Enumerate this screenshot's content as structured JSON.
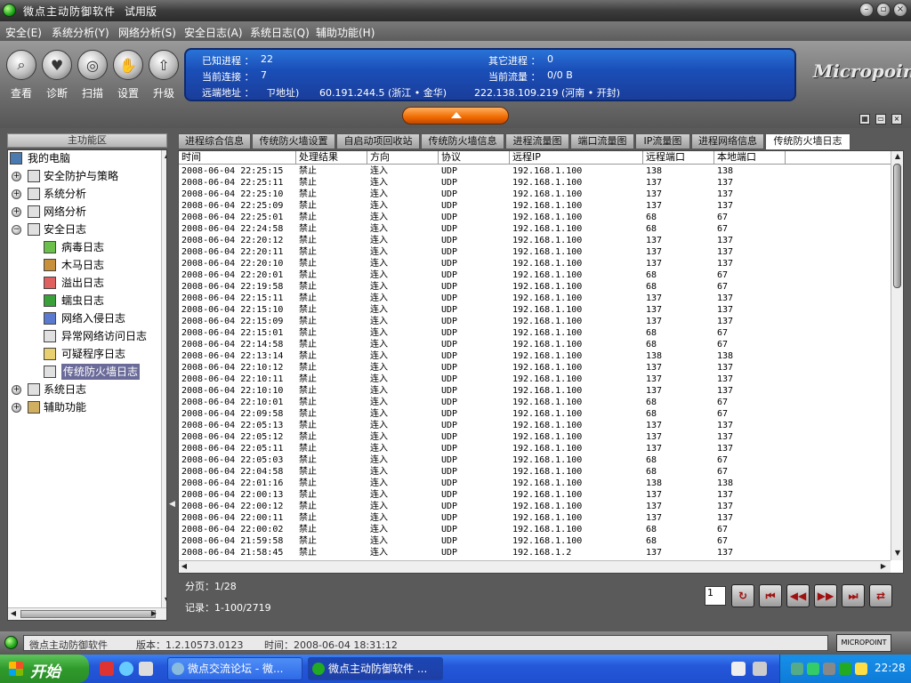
{
  "window": {
    "title": "微点主动防御软件",
    "edition": "试用版"
  },
  "menu": [
    "安全(E)",
    "系统分析(Y)",
    "网络分析(S)",
    "安全日志(A)",
    "系统日志(Q)",
    "辅助功能(H)"
  ],
  "toolbar": [
    "查看",
    "诊断",
    "扫描",
    "设置",
    "升级"
  ],
  "info": {
    "known_proc_label": "已知进程 ：",
    "known_proc": "22",
    "other_proc_label": "其它进程 ：",
    "other_proc": "0",
    "conn_label": "当前连接 ：",
    "conn": "7",
    "traffic_label": "当前流量 ：",
    "traffic": "0/0 B",
    "remote_label": "远端地址 ：",
    "remote_note": "ㄗ地址)",
    "remote_1": "60.191.244.5 (浙江 • 金华)",
    "remote_2": "222.138.109.219 (河南 • 开封)"
  },
  "logo": "Micropoint",
  "tree": {
    "header": "主功能区",
    "root": "我的电脑",
    "items": [
      "安全防护与策略",
      "系统分析",
      "网络分析",
      "安全日志",
      "病毒日志",
      "木马日志",
      "溢出日志",
      "蠕虫日志",
      "网络入侵日志",
      "异常网络访问日志",
      "可疑程序日志",
      "传统防火墙日志",
      "系统日志",
      "辅助功能"
    ]
  },
  "tabs": [
    "进程综合信息",
    "传统防火墙设置",
    "自启动项回收站",
    "传统防火墙信息",
    "进程流量图",
    "端口流量图",
    "IP流量图",
    "进程网络信息",
    "传统防火墙日志"
  ],
  "table": {
    "columns": [
      "时间",
      "处理结果",
      "方向",
      "协议",
      "远程IP",
      "远程端口",
      "本地端口"
    ],
    "rows": [
      [
        "2008-06-04 22:25:15",
        "禁止",
        "连入",
        "UDP",
        "192.168.1.100",
        "138",
        "138"
      ],
      [
        "2008-06-04 22:25:11",
        "禁止",
        "连入",
        "UDP",
        "192.168.1.100",
        "137",
        "137"
      ],
      [
        "2008-06-04 22:25:10",
        "禁止",
        "连入",
        "UDP",
        "192.168.1.100",
        "137",
        "137"
      ],
      [
        "2008-06-04 22:25:09",
        "禁止",
        "连入",
        "UDP",
        "192.168.1.100",
        "137",
        "137"
      ],
      [
        "2008-06-04 22:25:01",
        "禁止",
        "连入",
        "UDP",
        "192.168.1.100",
        "68",
        "67"
      ],
      [
        "2008-06-04 22:24:58",
        "禁止",
        "连入",
        "UDP",
        "192.168.1.100",
        "68",
        "67"
      ],
      [
        "2008-06-04 22:20:12",
        "禁止",
        "连入",
        "UDP",
        "192.168.1.100",
        "137",
        "137"
      ],
      [
        "2008-06-04 22:20:11",
        "禁止",
        "连入",
        "UDP",
        "192.168.1.100",
        "137",
        "137"
      ],
      [
        "2008-06-04 22:20:10",
        "禁止",
        "连入",
        "UDP",
        "192.168.1.100",
        "137",
        "137"
      ],
      [
        "2008-06-04 22:20:01",
        "禁止",
        "连入",
        "UDP",
        "192.168.1.100",
        "68",
        "67"
      ],
      [
        "2008-06-04 22:19:58",
        "禁止",
        "连入",
        "UDP",
        "192.168.1.100",
        "68",
        "67"
      ],
      [
        "2008-06-04 22:15:11",
        "禁止",
        "连入",
        "UDP",
        "192.168.1.100",
        "137",
        "137"
      ],
      [
        "2008-06-04 22:15:10",
        "禁止",
        "连入",
        "UDP",
        "192.168.1.100",
        "137",
        "137"
      ],
      [
        "2008-06-04 22:15:09",
        "禁止",
        "连入",
        "UDP",
        "192.168.1.100",
        "137",
        "137"
      ],
      [
        "2008-06-04 22:15:01",
        "禁止",
        "连入",
        "UDP",
        "192.168.1.100",
        "68",
        "67"
      ],
      [
        "2008-06-04 22:14:58",
        "禁止",
        "连入",
        "UDP",
        "192.168.1.100",
        "68",
        "67"
      ],
      [
        "2008-06-04 22:13:14",
        "禁止",
        "连入",
        "UDP",
        "192.168.1.100",
        "138",
        "138"
      ],
      [
        "2008-06-04 22:10:12",
        "禁止",
        "连入",
        "UDP",
        "192.168.1.100",
        "137",
        "137"
      ],
      [
        "2008-06-04 22:10:11",
        "禁止",
        "连入",
        "UDP",
        "192.168.1.100",
        "137",
        "137"
      ],
      [
        "2008-06-04 22:10:10",
        "禁止",
        "连入",
        "UDP",
        "192.168.1.100",
        "137",
        "137"
      ],
      [
        "2008-06-04 22:10:01",
        "禁止",
        "连入",
        "UDP",
        "192.168.1.100",
        "68",
        "67"
      ],
      [
        "2008-06-04 22:09:58",
        "禁止",
        "连入",
        "UDP",
        "192.168.1.100",
        "68",
        "67"
      ],
      [
        "2008-06-04 22:05:13",
        "禁止",
        "连入",
        "UDP",
        "192.168.1.100",
        "137",
        "137"
      ],
      [
        "2008-06-04 22:05:12",
        "禁止",
        "连入",
        "UDP",
        "192.168.1.100",
        "137",
        "137"
      ],
      [
        "2008-06-04 22:05:11",
        "禁止",
        "连入",
        "UDP",
        "192.168.1.100",
        "137",
        "137"
      ],
      [
        "2008-06-04 22:05:03",
        "禁止",
        "连入",
        "UDP",
        "192.168.1.100",
        "68",
        "67"
      ],
      [
        "2008-06-04 22:04:58",
        "禁止",
        "连入",
        "UDP",
        "192.168.1.100",
        "68",
        "67"
      ],
      [
        "2008-06-04 22:01:16",
        "禁止",
        "连入",
        "UDP",
        "192.168.1.100",
        "138",
        "138"
      ],
      [
        "2008-06-04 22:00:13",
        "禁止",
        "连入",
        "UDP",
        "192.168.1.100",
        "137",
        "137"
      ],
      [
        "2008-06-04 22:00:12",
        "禁止",
        "连入",
        "UDP",
        "192.168.1.100",
        "137",
        "137"
      ],
      [
        "2008-06-04 22:00:11",
        "禁止",
        "连入",
        "UDP",
        "192.168.1.100",
        "137",
        "137"
      ],
      [
        "2008-06-04 22:00:02",
        "禁止",
        "连入",
        "UDP",
        "192.168.1.100",
        "68",
        "67"
      ],
      [
        "2008-06-04 21:59:58",
        "禁止",
        "连入",
        "UDP",
        "192.168.1.100",
        "68",
        "67"
      ],
      [
        "2008-06-04 21:58:45",
        "禁止",
        "连入",
        "UDP",
        "192.168.1.2",
        "137",
        "137"
      ]
    ]
  },
  "pager": {
    "page_label": "分页：1/28",
    "records_label": "记录：1-100/2719",
    "page_input": "1"
  },
  "status": {
    "app": "微点主动防御软件",
    "version": "版本：1.2.10573.0123",
    "time": "时间：2008-06-04 18:31:12",
    "badge": "MICROPOINT"
  },
  "taskbar": {
    "start": "开始",
    "tasks": [
      "微点交流论坛 - 微...",
      "微点主动防御软件 ..."
    ],
    "clock": "22:28"
  }
}
